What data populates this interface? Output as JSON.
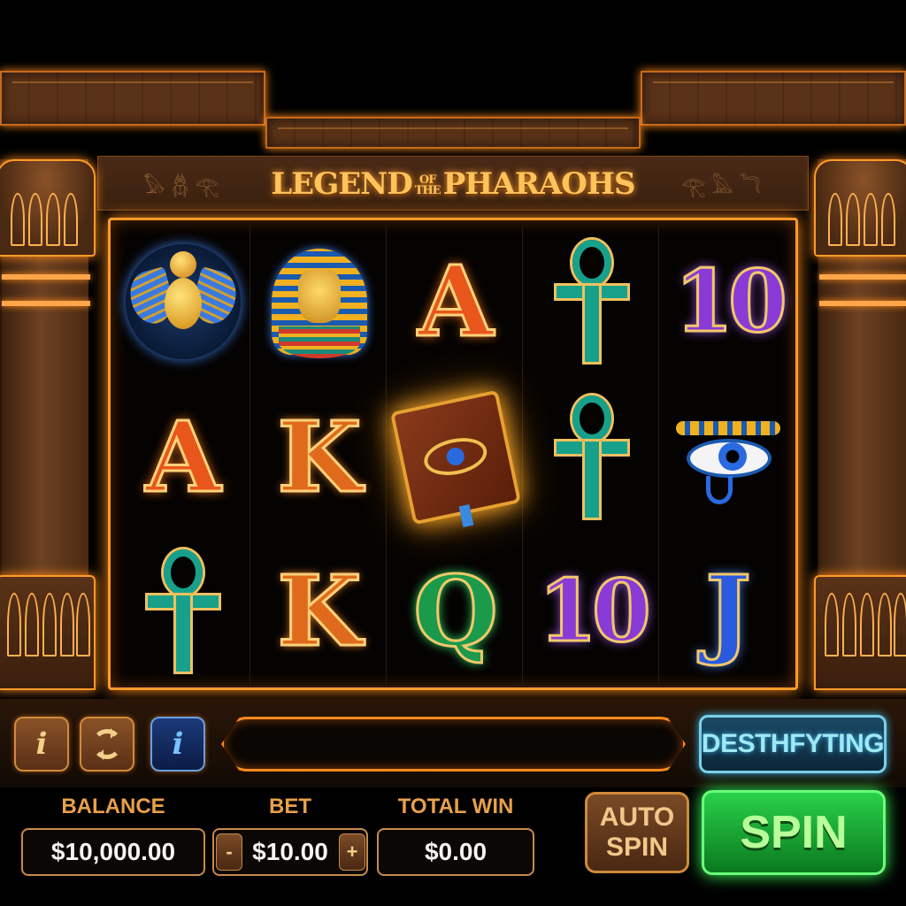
{
  "game": {
    "title_main_left": "LEGEND",
    "title_small_top": "OF",
    "title_small_bottom": "THE",
    "title_main_right": "PHARAOHS"
  },
  "reels": [
    [
      {
        "symbol": "scarab-icon"
      },
      {
        "symbol": "letter",
        "text": "A",
        "color": "#e8561c"
      },
      {
        "symbol": "ankh-icon"
      }
    ],
    [
      {
        "symbol": "pharaoh-icon"
      },
      {
        "symbol": "letter",
        "text": "K",
        "color": "#e06a1c"
      },
      {
        "symbol": "letter",
        "text": "K",
        "color": "#e06a1c"
      }
    ],
    [
      {
        "symbol": "letter",
        "text": "A",
        "color": "#e8561c"
      },
      {
        "symbol": "book-icon"
      },
      {
        "symbol": "letter",
        "text": "Q",
        "color": "#1a9a4a"
      }
    ],
    [
      {
        "symbol": "ankh-icon"
      },
      {
        "symbol": "ankh-icon"
      },
      {
        "symbol": "letter",
        "text": "10",
        "color": "#8a3ad6"
      }
    ],
    [
      {
        "symbol": "letter",
        "text": "10",
        "color": "#8a3ad6"
      },
      {
        "symbol": "eye-of-horus-icon"
      },
      {
        "symbol": "letter",
        "text": "J",
        "color": "#2a5ae0"
      }
    ]
  ],
  "controls": {
    "info_label": "i",
    "info2_label": "i",
    "feature_label": "DESTHFYTING",
    "message": "",
    "balance_label": "BALANCE",
    "balance_value": "$10,000.00",
    "bet_label": "BET",
    "bet_value": "$10.00",
    "bet_minus": "-",
    "bet_plus": "+",
    "total_win_label": "TOTAL WIN",
    "total_win_value": "$0.00",
    "auto_line1": "AUTO",
    "auto_line2": "SPIN",
    "spin_label": "SPIN"
  },
  "colors": {
    "frame_glow": "#ff9a2a",
    "spin_green": "#2ad04a",
    "feature_cyan": "#7ad0e8"
  }
}
